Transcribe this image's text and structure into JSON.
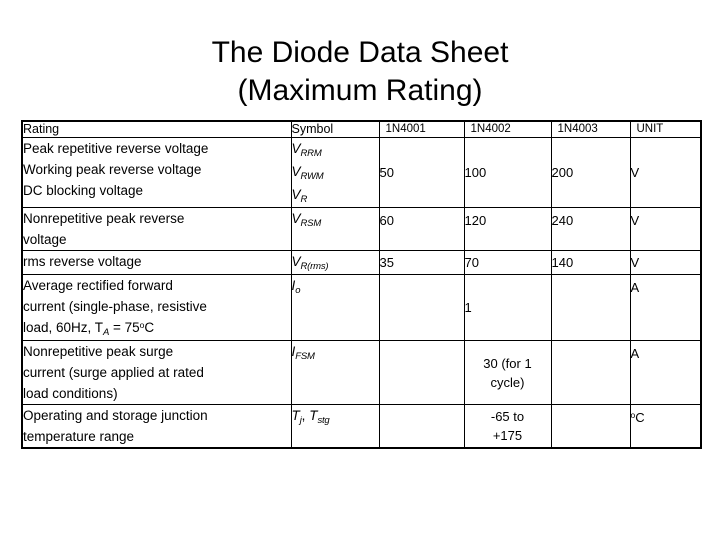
{
  "slide": {
    "title_line1": "The Diode Data Sheet",
    "title_line2": "(Maximum Rating)"
  },
  "table": {
    "columns": [
      {
        "key": "rating",
        "label": "Rating"
      },
      {
        "key": "symbol",
        "label": "Symbol"
      },
      {
        "key": "p1",
        "label": "1N4001"
      },
      {
        "key": "p2",
        "label": "1N4002"
      },
      {
        "key": "p3",
        "label": "1N4003"
      },
      {
        "key": "unit",
        "label": "UNIT"
      }
    ],
    "rows": [
      {
        "rating_lines": [
          "Peak repetitive reverse voltage",
          "Working peak reverse voltage",
          "DC blocking voltage"
        ],
        "symbol_lines": [
          {
            "base": "V",
            "sub": "RRM"
          },
          {
            "base": "V",
            "sub": "RWM"
          },
          {
            "base": "V",
            "sub": "R"
          }
        ],
        "p1": "50",
        "p2": "100",
        "p3": "200",
        "unit": "V"
      },
      {
        "rating_lines": [
          "Nonrepetitive peak reverse",
          "voltage"
        ],
        "symbol_lines": [
          {
            "base": "V",
            "sub": "RSM"
          }
        ],
        "p1": "60",
        "p2": "120",
        "p3": "240",
        "unit": "V"
      },
      {
        "rating_lines": [
          "rms reverse voltage"
        ],
        "symbol_lines": [
          {
            "base": "V",
            "sub": "R(rms)"
          }
        ],
        "p1": "35",
        "p2": "70",
        "p3": "140",
        "unit": "V"
      },
      {
        "rating_lines": [
          "Average rectified forward",
          "current (single-phase, resistive",
          "load, 60Hz, T_A = 75degC"
        ],
        "symbol_lines": [
          {
            "base": "I",
            "sub": "o"
          }
        ],
        "p1": "",
        "p2": "1",
        "p3": "",
        "unit": "A"
      },
      {
        "rating_lines": [
          "Nonrepetitive peak surge",
          "current (surge applied at rated",
          "load conditions)"
        ],
        "symbol_lines": [
          {
            "base": "I",
            "sub": "FSM"
          }
        ],
        "p1": "",
        "p2_lines": [
          "30 (for 1",
          "cycle)"
        ],
        "p3": "",
        "unit": "A"
      },
      {
        "rating_lines": [
          "Operating and storage junction",
          "temperature range"
        ],
        "symbol_lines": [
          {
            "base": "T",
            "sub": "j",
            "sep": ", "
          },
          {
            "base": "T",
            "sub": "stg"
          }
        ],
        "p1": "",
        "p2_lines": [
          "-65 to",
          "+175"
        ],
        "p3": "",
        "unit": "degC"
      }
    ]
  },
  "cells": {
    "r0_rl0": "Peak repetitive reverse voltage",
    "r0_rl1": "Working peak reverse voltage",
    "r0_rl2": "DC blocking voltage",
    "r0_sym0_b": "V",
    "r0_sym0_s": "RRM",
    "r0_sym1_b": "V",
    "r0_sym1_s": "RWM",
    "r0_sym2_b": "V",
    "r0_sym2_s": "R",
    "r0_p1": "50",
    "r0_p2": "100",
    "r0_p3": "200",
    "r0_unit": "V",
    "r1_rl0": "Nonrepetitive peak reverse",
    "r1_rl1": "voltage",
    "r1_sym0_b": "V",
    "r1_sym0_s": "RSM",
    "r1_p1": "60",
    "r1_p2": "120",
    "r1_p3": "240",
    "r1_unit": "V",
    "r2_rl0": "rms reverse voltage",
    "r2_sym0_b": "V",
    "r2_sym0_s": "R(rms)",
    "r2_p1": "35",
    "r2_p2": "70",
    "r2_p3": "140",
    "r2_unit": "V",
    "r3_rl0": "Average rectified forward",
    "r3_rl1": "current (single-phase, resistive",
    "r3_rl2a": "load, 60Hz, T",
    "r3_rl2sub": "A",
    "r3_rl2b": " = 75",
    "r3_rl2sup": "o",
    "r3_rl2c": "C",
    "r3_sym0_b": "I",
    "r3_sym0_s": "o",
    "r3_p2": "1",
    "r3_unit": "A",
    "r4_rl0": "Nonrepetitive peak surge",
    "r4_rl1": "current (surge applied at rated",
    "r4_rl2": "load conditions)",
    "r4_sym0_b": "I",
    "r4_sym0_s": "FSM",
    "r4_p2l0": "30 (for 1",
    "r4_p2l1": "cycle)",
    "r4_unit": "A",
    "r5_rl0": "Operating and storage junction",
    "r5_rl1": "temperature range",
    "r5_sym0_b": "T",
    "r5_sym0_s": "j",
    "r5_symsep": ", ",
    "r5_sym1_b": "T",
    "r5_sym1_s": "stg",
    "r5_p2l0": "-65 to",
    "r5_p2l1": "+175",
    "r5_unit_sup": "o",
    "r5_unit_b": "C"
  }
}
